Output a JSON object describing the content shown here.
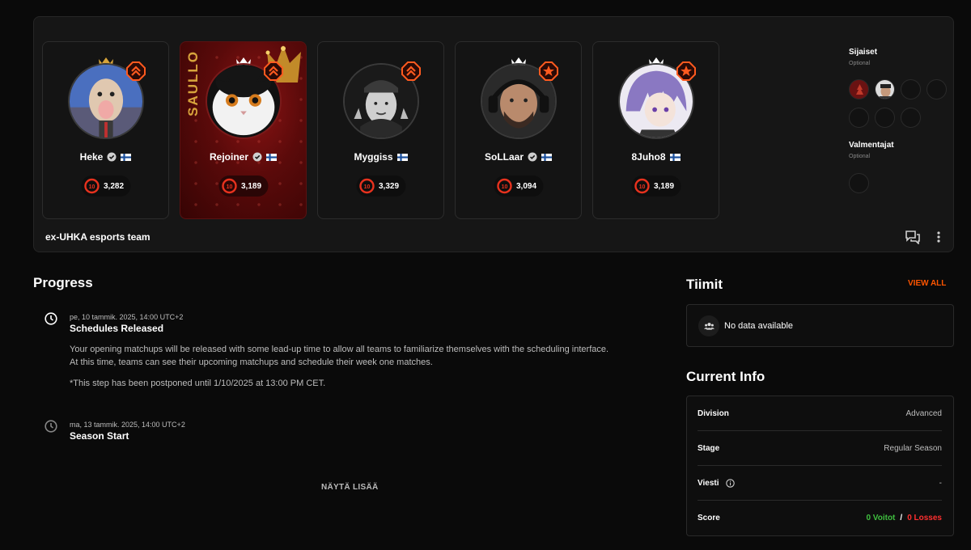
{
  "team": {
    "name": "ex-UHKA esports team"
  },
  "players": [
    {
      "name": "Heke",
      "elo": "3,282",
      "level": "10",
      "verified": true,
      "flag": "FI",
      "badge": "rank-chevrons",
      "crown": "gold"
    },
    {
      "name": "Rejoiner",
      "elo": "3,189",
      "level": "10",
      "verified": true,
      "flag": "FI",
      "badge": "rank-chevrons",
      "crown": "white",
      "featured_label": "SAULLO"
    },
    {
      "name": "Myggiss",
      "elo": "3,329",
      "level": "10",
      "verified": false,
      "flag": "FI",
      "badge": "rank-chevrons",
      "crown": "none"
    },
    {
      "name": "SoLLaar",
      "elo": "3,094",
      "level": "10",
      "verified": true,
      "flag": "FI",
      "badge": "rank-star",
      "crown": "white"
    },
    {
      "name": "8Juho8",
      "elo": "3,189",
      "level": "10",
      "verified": false,
      "flag": "FI",
      "badge": "rank-star",
      "crown": "white"
    }
  ],
  "substitutes": {
    "title": "Sijaiset",
    "subtitle": "Optional"
  },
  "coaches": {
    "title": "Valmentajat",
    "subtitle": "Optional"
  },
  "progress": {
    "title": "Progress",
    "steps": [
      {
        "time": "pe, 10 tammik. 2025, 14:00 UTC+2",
        "title": "Schedules Released",
        "body_1": "Your opening matchups will be released with some lead-up time to allow all teams to familiarize themselves with the scheduling interface.",
        "body_2": "At this time, teams can see their upcoming matchups and schedule their week one matches.",
        "note": "*This step has been postponed until 1/10/2025 at 13:00 PM CET."
      },
      {
        "time": "ma, 13 tammik. 2025, 14:00 UTC+2",
        "title": "Season Start"
      }
    ],
    "show_more": "NÄYTÄ LISÄÄ"
  },
  "teams_section": {
    "title": "Tiimit",
    "view_all": "VIEW ALL",
    "empty": "No data available"
  },
  "current_info": {
    "title": "Current Info",
    "division_label": "Division",
    "division_value": "Advanced",
    "stage_label": "Stage",
    "stage_value": "Regular Season",
    "message_label": "Viesti",
    "message_value": "-",
    "score_label": "Score",
    "wins": "0 Voitot",
    "separator": "/",
    "losses": "0 Losses"
  },
  "colors": {
    "accent": "#ff5500",
    "level": "#e8321e",
    "win": "#3fbf3f",
    "loss": "#ff2f2f"
  }
}
